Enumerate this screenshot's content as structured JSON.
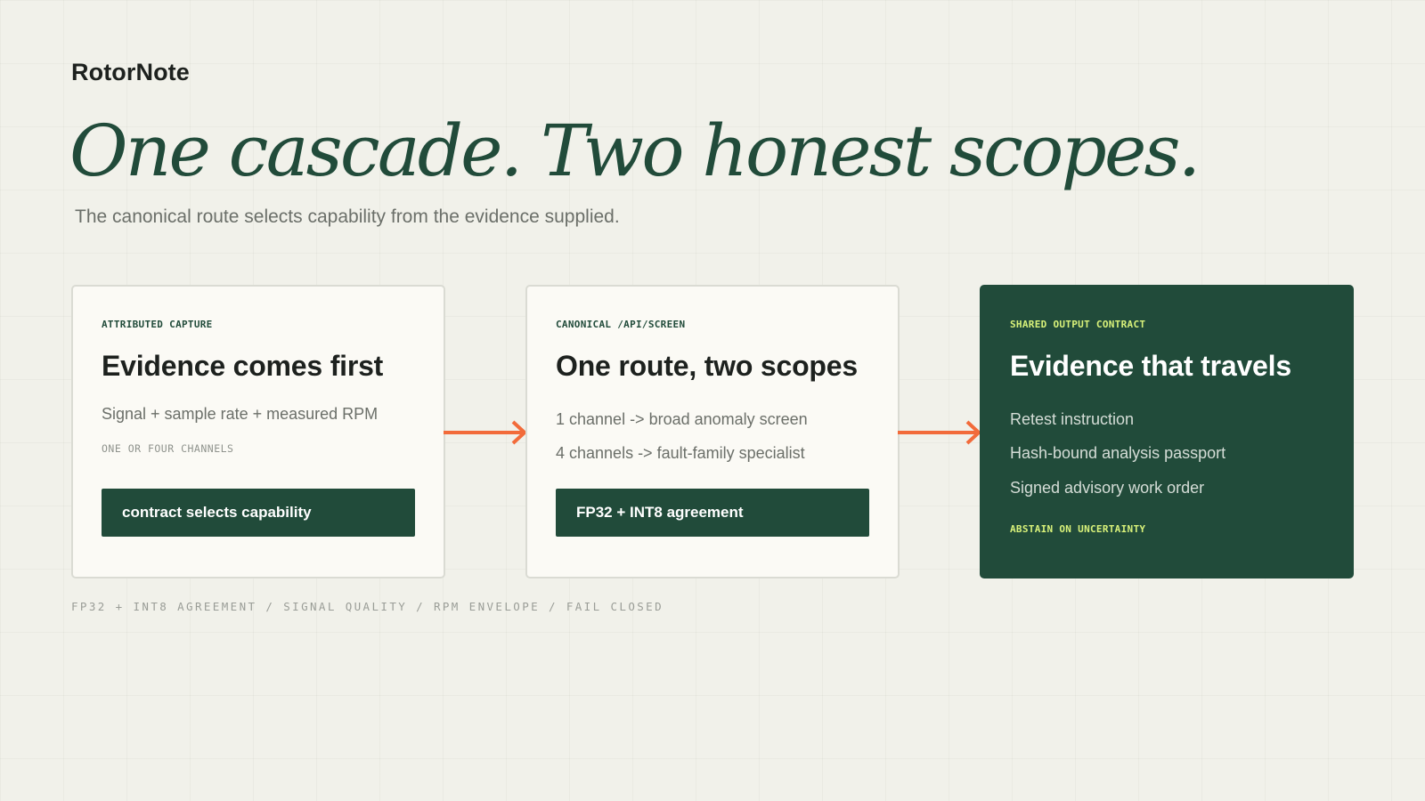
{
  "brand": "RotorNote",
  "headline": "One cascade. Two honest scopes.",
  "subhead": "The canonical route selects capability from the evidence supplied.",
  "colors": {
    "accent_green": "#214b3a",
    "arrow_orange": "#f26b3a",
    "highlight_lime": "#d9f27a",
    "background": "#f1f1ea"
  },
  "cards": [
    {
      "eyebrow": "ATTRIBUTED CAPTURE",
      "title": "Evidence comes first",
      "description": "Signal + sample rate + measured RPM",
      "note": "ONE OR FOUR CHANNELS",
      "action_label": "contract selects capability"
    },
    {
      "eyebrow": "CANONICAL /API/SCREEN",
      "title": "One route, two scopes",
      "items": [
        "1 channel -> broad anomaly screen",
        "4 channels -> fault-family specialist"
      ],
      "action_label": "FP32 + INT8 agreement"
    },
    {
      "eyebrow": "SHARED OUTPUT CONTRACT",
      "title": "Evidence that travels",
      "items": [
        "Retest instruction",
        "Hash-bound analysis passport",
        "Signed advisory work order"
      ],
      "footer": "ABSTAIN ON UNCERTAINTY"
    }
  ],
  "arrows": [
    "arrow-right-icon",
    "arrow-right-icon"
  ],
  "footer_note": "FP32 + INT8 AGREEMENT / SIGNAL QUALITY / RPM ENVELOPE / FAIL CLOSED"
}
